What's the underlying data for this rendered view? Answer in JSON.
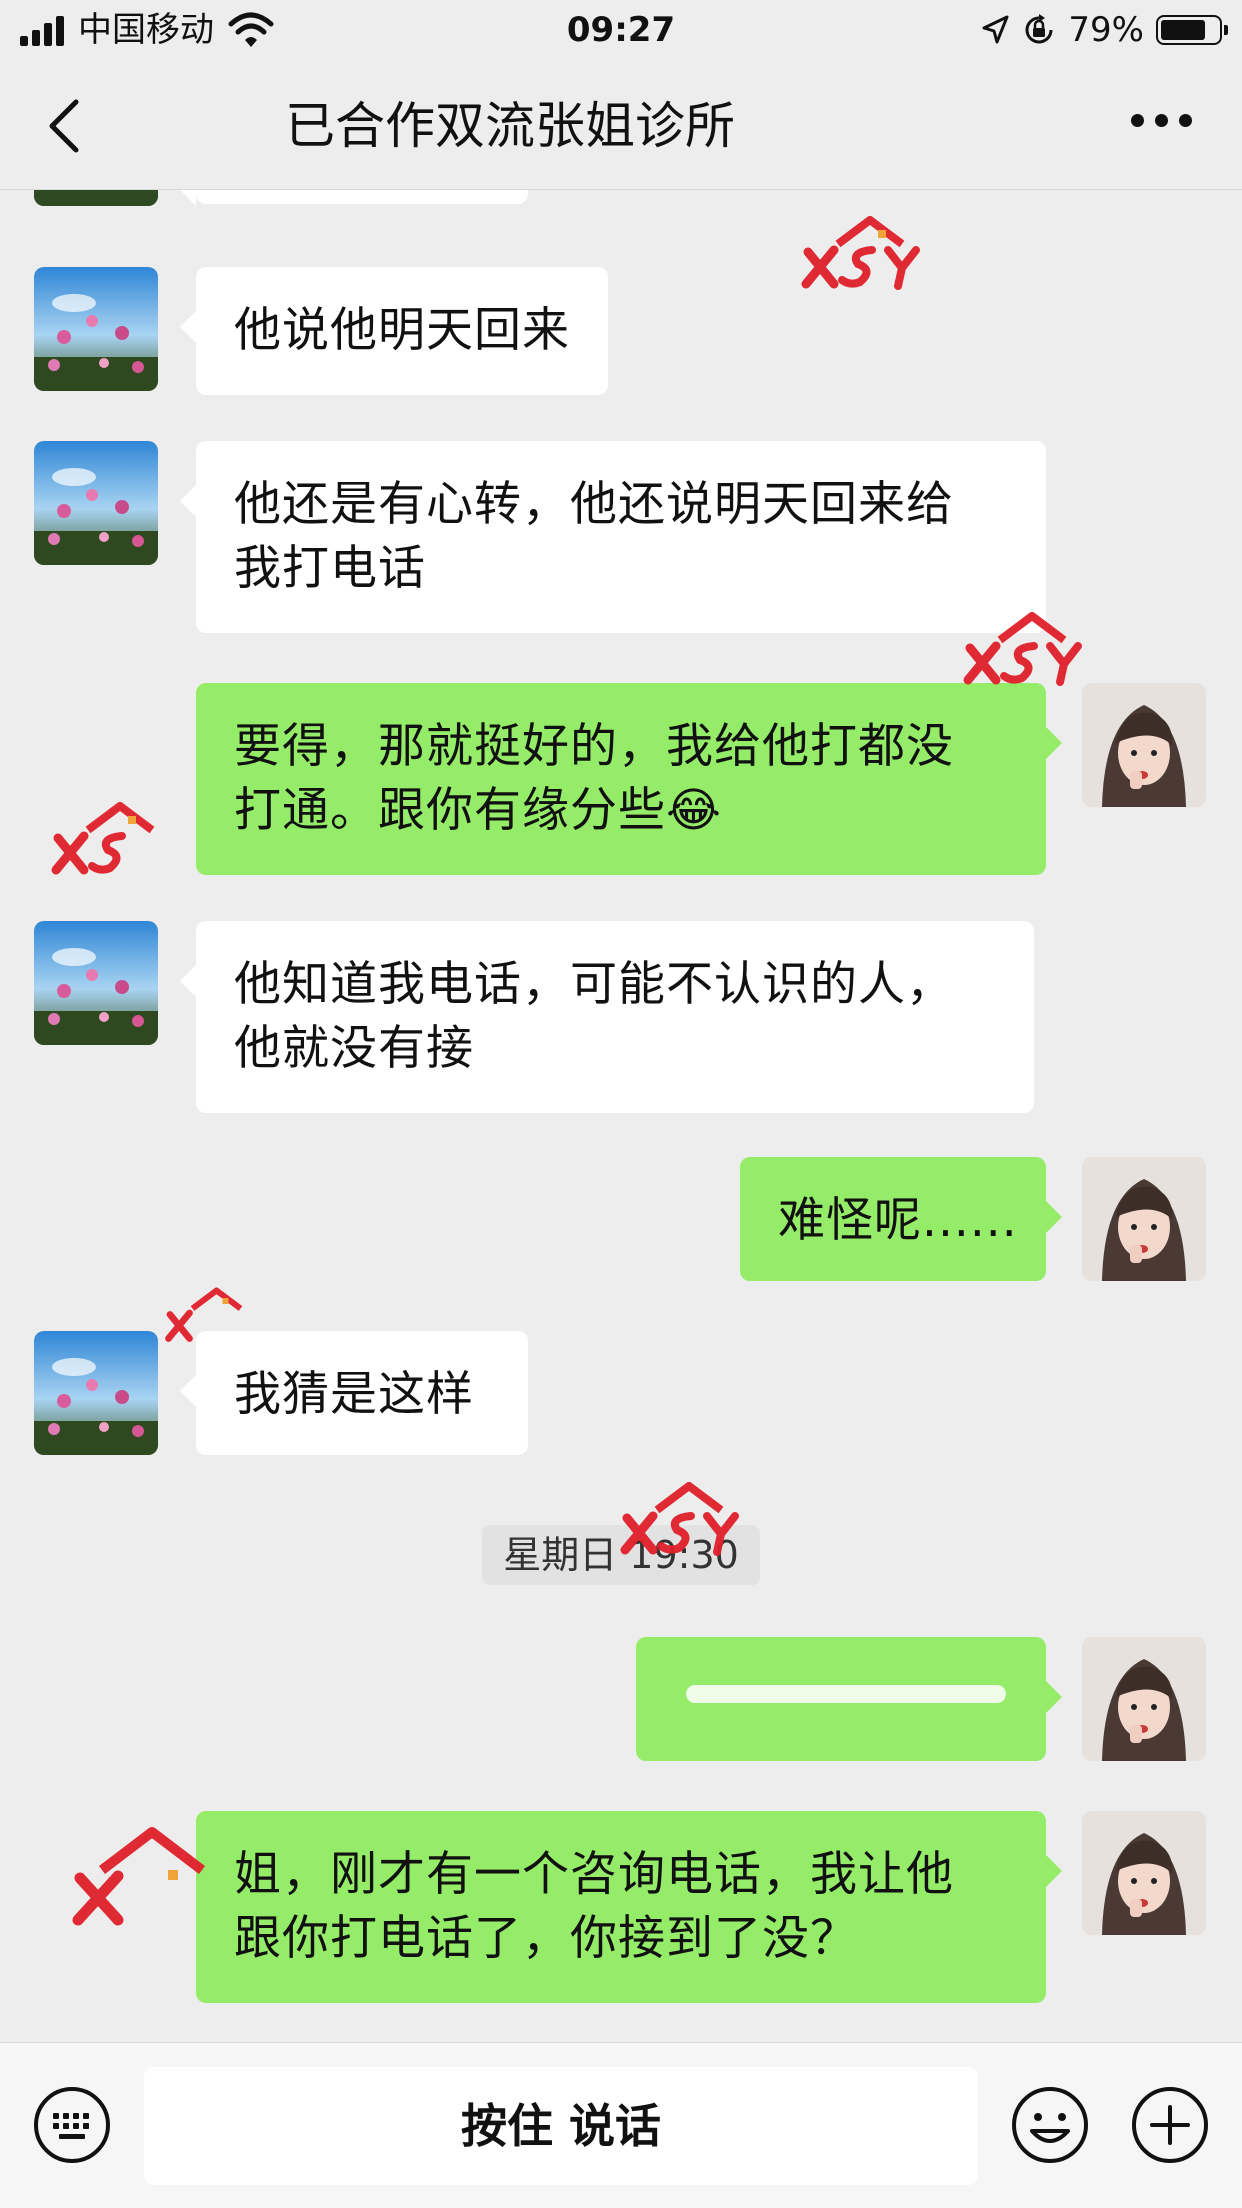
{
  "status_bar": {
    "carrier": "中国移动",
    "time": "09:27",
    "battery_percent_label": "79%",
    "battery_level": 0.79,
    "icons": [
      "signal-icon",
      "wifi-icon",
      "location-arrow-icon",
      "rotation-lock-icon",
      "battery-icon"
    ]
  },
  "nav": {
    "title": "已合作双流张姐诊所",
    "back_icon": "chevron-left-icon",
    "more_icon": "more-dots-icon"
  },
  "messages": [
    {
      "side": "in",
      "lines": [
        "他说他明天回来"
      ]
    },
    {
      "side": "in",
      "lines": [
        "他还是有心转，他还说明天回来给",
        "我打电话"
      ]
    },
    {
      "side": "out",
      "lines": [
        "要得，那就挺好的，我给他打都没",
        "打通。跟你有缘分些😂"
      ]
    },
    {
      "side": "in",
      "lines": [
        "他知道我电话，可能不认识的人，",
        "他就没有接"
      ]
    },
    {
      "side": "out",
      "lines": [
        "难怪呢......"
      ]
    },
    {
      "side": "in",
      "lines": [
        "我猜是这样"
      ]
    },
    {
      "side": "out",
      "lines": [
        ""
      ]
    },
    {
      "side": "out",
      "lines": [
        "姐，刚才有一个咨询电话，我让他",
        "跟你打电话了，你接到了没？"
      ]
    }
  ],
  "time_separator": "星期日 19:30",
  "input_bar": {
    "hold_to_talk": "按住 说话",
    "icons": [
      "keyboard-icon",
      "emoji-icon",
      "plus-icon"
    ]
  },
  "watermark_text": "XSY",
  "colors": {
    "background": "#EDEDED",
    "incoming_bubble": "#FFFFFF",
    "outgoing_bubble": "#95EC69",
    "watermark": "#E0202A"
  }
}
